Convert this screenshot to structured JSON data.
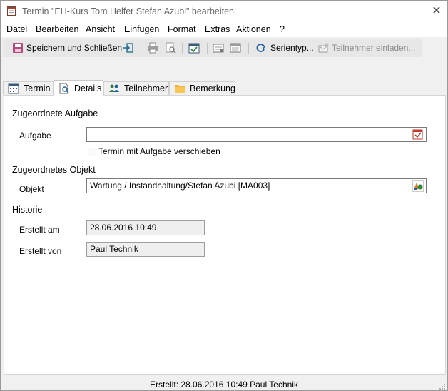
{
  "window": {
    "title": "Termin \"EH-Kurs Tom Helfer Stefan Azubi\" bearbeiten",
    "app_icon": "calendar-clipboard-icon",
    "close_symbol": "✕"
  },
  "menu": [
    {
      "label": "Datei"
    },
    {
      "label": "Bearbeiten"
    },
    {
      "label": "Ansicht"
    },
    {
      "label": "Einfügen"
    },
    {
      "label": "Format"
    },
    {
      "label": "Extras"
    },
    {
      "label": "Aktionen"
    },
    {
      "label": "?"
    }
  ],
  "toolbar": {
    "save_close_label": "Speichern und Schließen",
    "series_label": "Serientyp...",
    "invite_label": "Teilnehmer einladen...",
    "icons": [
      "save-icon",
      "exit-icon",
      "print-icon",
      "print-preview-icon",
      "calendar-check-icon",
      "insert-icon",
      "window-icon",
      "recurrence-icon",
      "invite-icon"
    ]
  },
  "tabs": [
    {
      "label": "Termin",
      "icon": "calendar-icon",
      "active": false
    },
    {
      "label": "Details",
      "icon": "document-search-icon",
      "active": true
    },
    {
      "label": "Teilnehmer",
      "icon": "people-icon",
      "active": false
    },
    {
      "label": "Bemerkung",
      "icon": "folder-note-icon",
      "active": false
    }
  ],
  "details": {
    "task_section": "Zugeordnete Aufgabe",
    "task_label": "Aufgabe",
    "task_value": "",
    "move_with_task_label": "Termin mit Aufgabe verschieben",
    "move_with_task_checked": false,
    "object_section": "Zugeordnetes Objekt",
    "object_label": "Objekt",
    "object_value": "Wartung / Instandhaltung/Stefan Azubi [MA003]",
    "history_section": "Historie",
    "created_at_label": "Erstellt am",
    "created_at_value": "28.06.2016 10:49",
    "created_by_label": "Erstellt von",
    "created_by_value": "Paul Technik"
  },
  "statusbar": {
    "text": "Erstellt: 28.06.2016 10:49 Paul Technik"
  }
}
